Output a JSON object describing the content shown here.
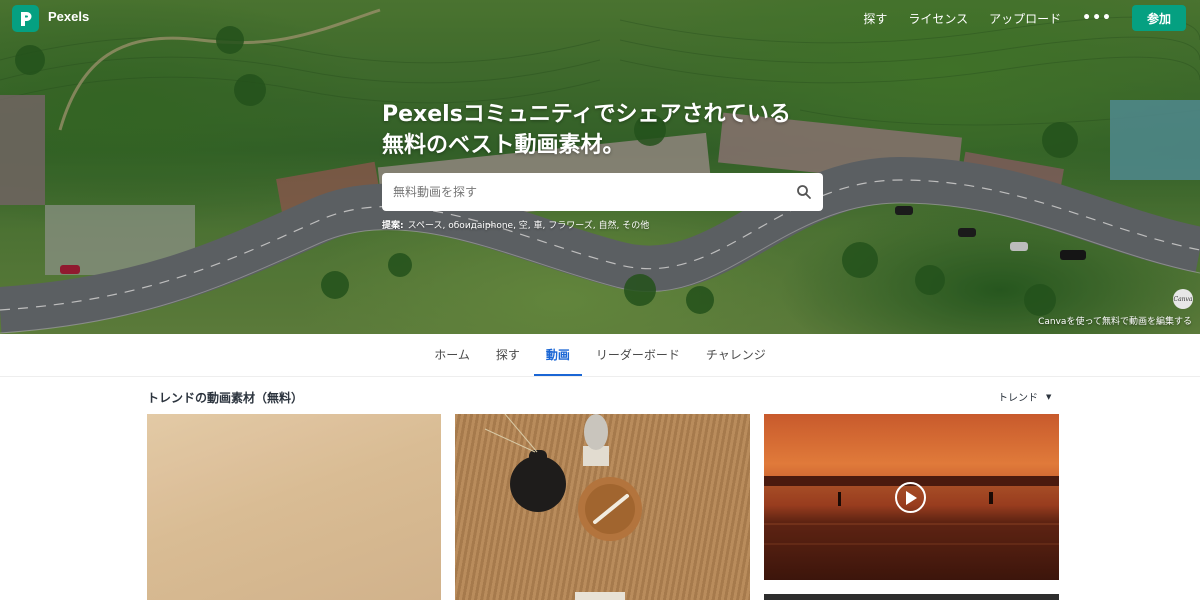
{
  "nav": {
    "brand": "Pexels",
    "links": [
      "探す",
      "ライセンス",
      "アップロード"
    ],
    "more": "•••",
    "join": "参加"
  },
  "hero": {
    "title_line1": "Pexelsコミュニティでシェアされている",
    "title_line2": "無料のベスト動画素材。",
    "search_placeholder": "無料動画を探す",
    "suggest_label": "提案:",
    "suggest_items": "スペース, обоидаiphone, 空, 車, フラワーズ, 自然, その他",
    "canva_badge": "Canva",
    "canva_caption": "Canvaを使って無料で動画を編集する"
  },
  "tabs": [
    "ホーム",
    "探す",
    "動画",
    "リーダーボード",
    "チャレンジ"
  ],
  "active_tab": "動画",
  "section": {
    "title": "トレンドの動画素材（無料）",
    "sort_label": "トレンド",
    "sort_caret": "▼"
  },
  "colors": {
    "accent": "#05a081",
    "active_tab": "#1a66d5"
  }
}
